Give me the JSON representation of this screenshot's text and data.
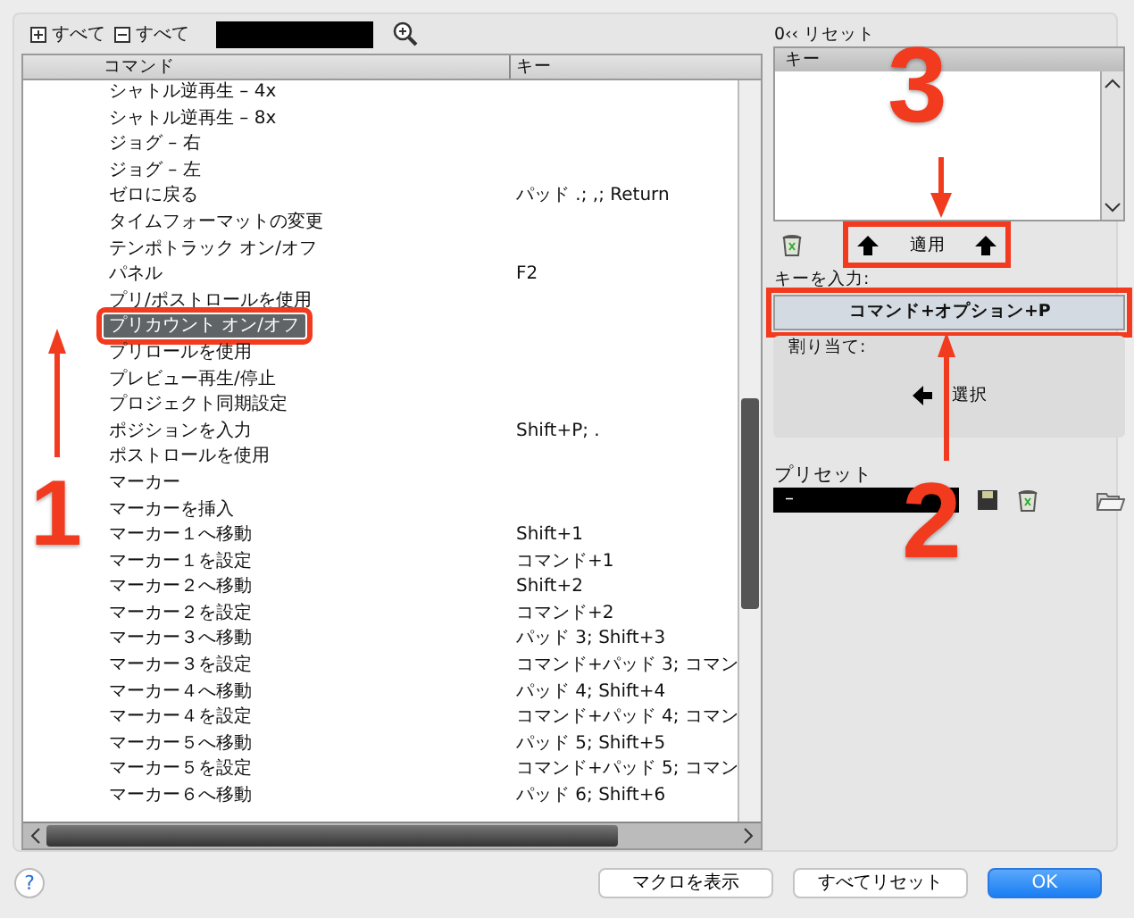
{
  "toolbar": {
    "expand_all": "すべて",
    "collapse_all": "すべて"
  },
  "table": {
    "columns": [
      "コマンド",
      "キー"
    ],
    "rows": [
      {
        "command": "シャトル逆再生 – 4x",
        "key": "",
        "selected": false
      },
      {
        "command": "シャトル逆再生 – 8x",
        "key": "",
        "selected": false
      },
      {
        "command": "ジョグ – 右",
        "key": "",
        "selected": false
      },
      {
        "command": "ジョグ – 左",
        "key": "",
        "selected": false
      },
      {
        "command": "ゼロに戻る",
        "key": "パッド .; ,; Return",
        "selected": false
      },
      {
        "command": "タイムフォーマットの変更",
        "key": "",
        "selected": false
      },
      {
        "command": "テンポトラック オン/オフ",
        "key": "",
        "selected": false
      },
      {
        "command": "パネル",
        "key": "F2",
        "selected": false
      },
      {
        "command": "プリ/ポストロールを使用",
        "key": "",
        "selected": false
      },
      {
        "command": "プリカウント オン/オフ",
        "key": "",
        "selected": true
      },
      {
        "command": "プリロールを使用",
        "key": "",
        "selected": false
      },
      {
        "command": "プレビュー再生/停止",
        "key": "",
        "selected": false
      },
      {
        "command": "プロジェクト同期設定",
        "key": "",
        "selected": false
      },
      {
        "command": "ポジションを入力",
        "key": "Shift+P; .",
        "selected": false
      },
      {
        "command": "ポストロールを使用",
        "key": "",
        "selected": false
      },
      {
        "command": "マーカー",
        "key": "",
        "selected": false
      },
      {
        "command": "マーカーを挿入",
        "key": "",
        "selected": false
      },
      {
        "command": "マーカー１へ移動",
        "key": "Shift+1",
        "selected": false
      },
      {
        "command": "マーカー１を設定",
        "key": "コマンド+1",
        "selected": false
      },
      {
        "command": "マーカー２へ移動",
        "key": "Shift+2",
        "selected": false
      },
      {
        "command": "マーカー２を設定",
        "key": "コマンド+2",
        "selected": false
      },
      {
        "command": "マーカー３へ移動",
        "key": "パッド 3; Shift+3",
        "selected": false
      },
      {
        "command": "マーカー３を設定",
        "key": "コマンド+パッド 3; コマン",
        "selected": false
      },
      {
        "command": "マーカー４へ移動",
        "key": "パッド 4; Shift+4",
        "selected": false
      },
      {
        "command": "マーカー４を設定",
        "key": "コマンド+パッド 4; コマン",
        "selected": false
      },
      {
        "command": "マーカー５へ移動",
        "key": "パッド 5; Shift+5",
        "selected": false
      },
      {
        "command": "マーカー５を設定",
        "key": "コマンド+パッド 5; コマン",
        "selected": false
      },
      {
        "command": "マーカー６へ移動",
        "key": "パッド 6; Shift+6",
        "selected": false
      }
    ]
  },
  "keys_panel": {
    "reset_label": "0‹‹ リセット",
    "list_header": "キー",
    "apply_button": "適用",
    "key_input_label": "キーを入力:",
    "key_input": "コマンド+オプション+P",
    "assign_label": "割り当て:",
    "select_button": "選択"
  },
  "preset": {
    "label": "プリセット",
    "value": "–"
  },
  "help": "?",
  "buttons": [
    {
      "label": "マクロを表示",
      "kind": "plain"
    },
    {
      "label": "すべてリセット",
      "kind": "plain"
    },
    {
      "label": "OK",
      "kind": "default"
    }
  ],
  "annotations": [
    "1",
    "2",
    "3"
  ]
}
